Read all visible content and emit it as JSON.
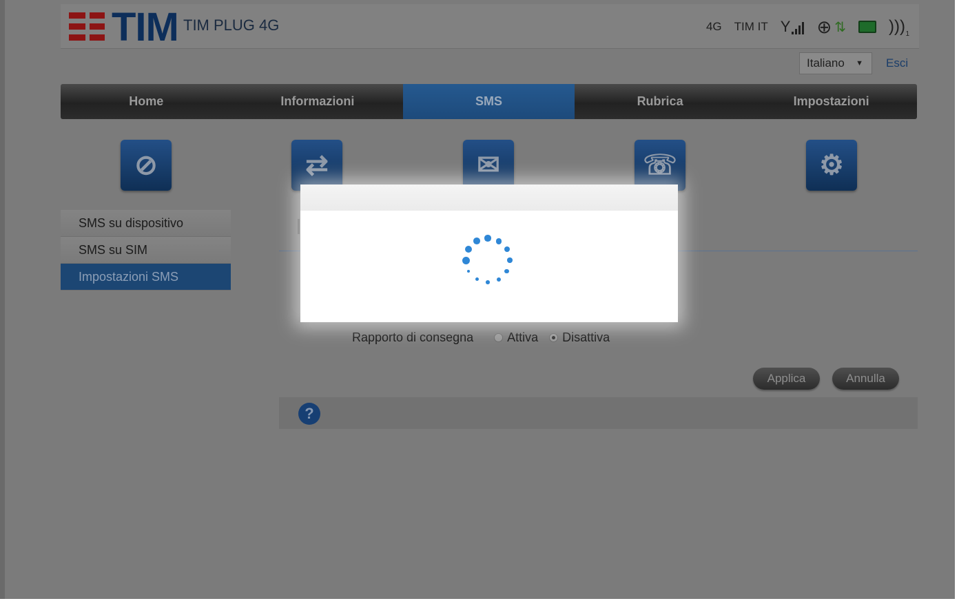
{
  "header": {
    "brand": "TIM",
    "product": "TIM PLUG 4G",
    "network_type": "4G",
    "operator": "TIM IT",
    "wifi_clients": "1"
  },
  "topbar": {
    "language": "Italiano",
    "logout": "Esci"
  },
  "nav": {
    "items": [
      {
        "label": "Home"
      },
      {
        "label": "Informazioni"
      },
      {
        "label": "SMS"
      },
      {
        "label": "Rubrica"
      },
      {
        "label": "Impostazioni"
      }
    ],
    "active": "SMS"
  },
  "sidebar": {
    "items": [
      {
        "label": "SMS su dispositivo"
      },
      {
        "label": "SMS su SIM"
      },
      {
        "label": "Impostazioni SMS"
      }
    ]
  },
  "main": {
    "delivery_label": "Rapporto di consegna",
    "options": [
      {
        "label": "Attiva",
        "checked": false
      },
      {
        "label": "Disattiva",
        "checked": true
      }
    ],
    "apply": "Applica",
    "cancel": "Annulla",
    "help_symbol": "?"
  },
  "colors": {
    "accent": "#2f87d6",
    "nav_active": "#1d4a7b",
    "brand_red": "#8c1414"
  }
}
